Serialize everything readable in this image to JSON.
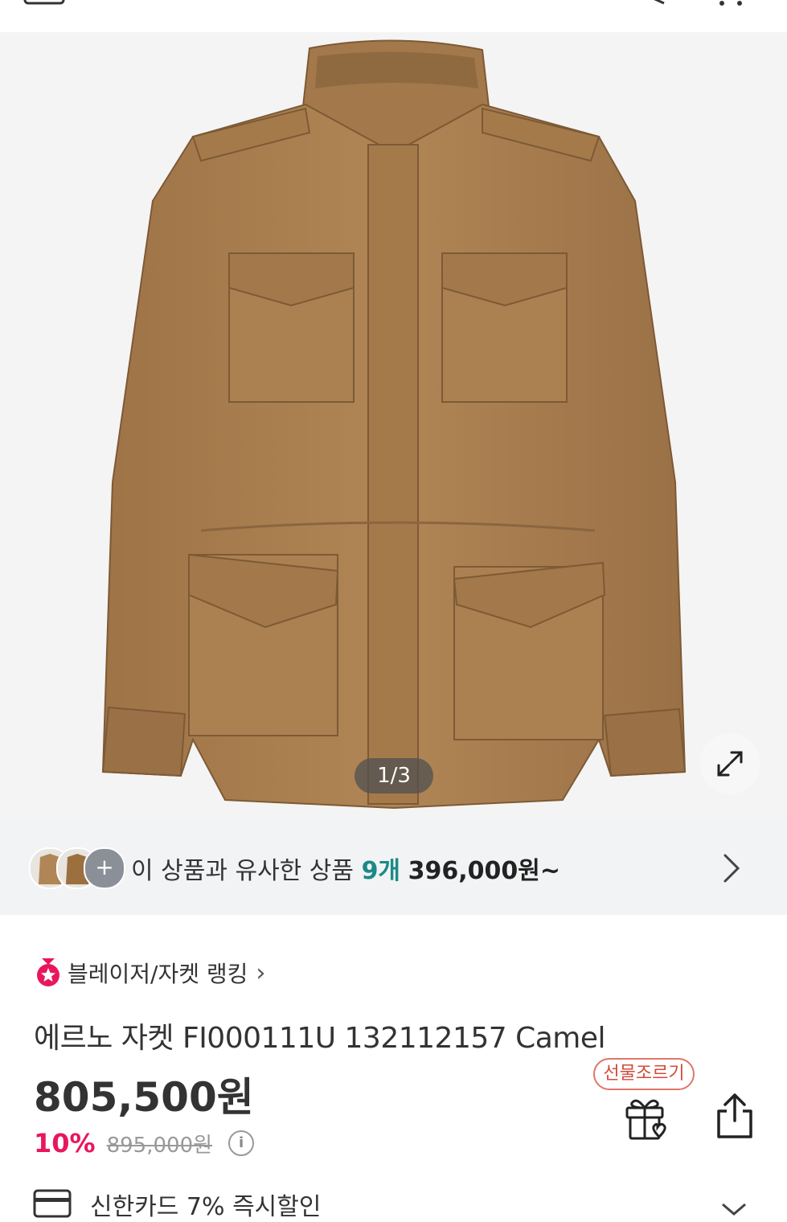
{
  "gallery": {
    "counter": "1/3",
    "expand_icon": "expand-icon"
  },
  "similar": {
    "plus": "+",
    "label": "이 상품과 유사한 상품",
    "count": "9개",
    "price": "396,000원~"
  },
  "ranking": {
    "label": "블레이저/자켓 랭킹",
    "chevron": "›"
  },
  "product": {
    "title": "에르노 자켓 FI000111U 132112157 Camel",
    "price": "805,500원",
    "discount": "10%",
    "original_price": "895,000원",
    "info": "i"
  },
  "actions": {
    "gift_badge": "선물조르기"
  },
  "card_promo": {
    "text": "신한카드 7% 즉시할인"
  },
  "colors": {
    "accent_teal": "#1b8a86",
    "discount_red": "#e8175d",
    "jacket_camel": "#a87c4f"
  }
}
